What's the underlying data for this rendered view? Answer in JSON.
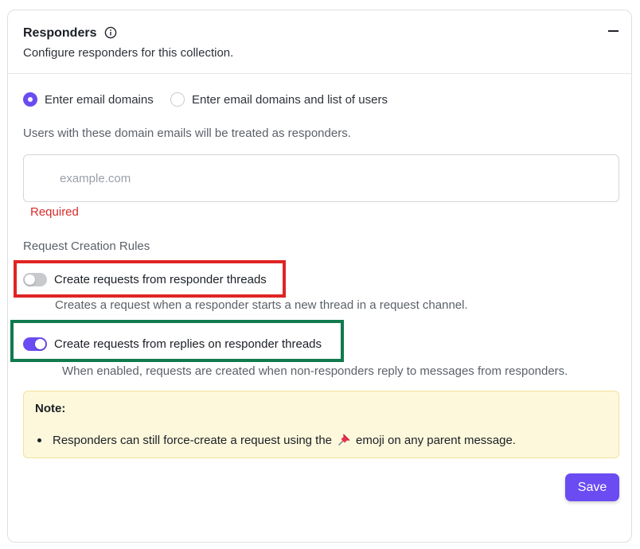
{
  "panel": {
    "title": "Responders",
    "subtitle": "Configure responders for this collection.",
    "info_icon": "info-icon",
    "collapse_icon": "minus-icon"
  },
  "responder_mode": {
    "options": [
      {
        "label": "Enter email domains",
        "selected": true
      },
      {
        "label": "Enter email domains and list of users",
        "selected": false
      }
    ]
  },
  "domains": {
    "helper": "Users with these domain emails will be treated as responders.",
    "placeholder": "example.com",
    "value": "",
    "error": "Required"
  },
  "rules": {
    "label": "Request Creation Rules",
    "toggles": [
      {
        "label": "Create requests from responder threads",
        "description": "Creates a request when a responder starts a new thread in a request channel.",
        "enabled": false
      },
      {
        "label": "Create requests from replies on responder threads",
        "description": "When enabled, requests are created when non-responders reply to messages from responders.",
        "enabled": true
      }
    ]
  },
  "note": {
    "title": "Note:",
    "text_before": "Responders can still force-create a request using the",
    "emoji_icon": "pushpin-icon",
    "text_after": "emoji on any parent message."
  },
  "actions": {
    "save_label": "Save"
  },
  "colors": {
    "accent": "#6a4cf2",
    "error": "#d92b2b",
    "highlight_red": "#e02424",
    "highlight_green": "#0f7a4d",
    "note_bg": "#fdf8dc"
  }
}
